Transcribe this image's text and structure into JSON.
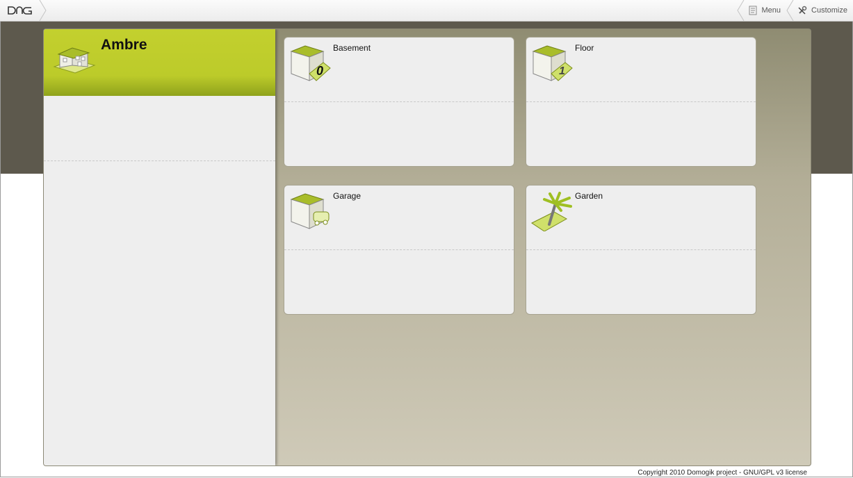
{
  "header": {
    "logo_text": "DMG",
    "nav": [
      {
        "label": "Menu",
        "icon": "menu-icon"
      },
      {
        "label": "Customize",
        "icon": "customize-icon"
      }
    ]
  },
  "house": {
    "name": "Ambre",
    "icon": "house-icon",
    "accent_color": "#bccb2a"
  },
  "rooms": [
    {
      "name": "Basement",
      "icon": "basement-icon",
      "badge": "0"
    },
    {
      "name": "Floor",
      "icon": "floor-icon",
      "badge": "1"
    },
    {
      "name": "Garage",
      "icon": "garage-icon"
    },
    {
      "name": "Garden",
      "icon": "garden-icon"
    }
  ],
  "footer": {
    "copyright": "Copyright 2010 Domogik project - GNU/GPL v3 license"
  },
  "colors": {
    "band": "#5d594d",
    "panel_light": "#eeeeee"
  }
}
